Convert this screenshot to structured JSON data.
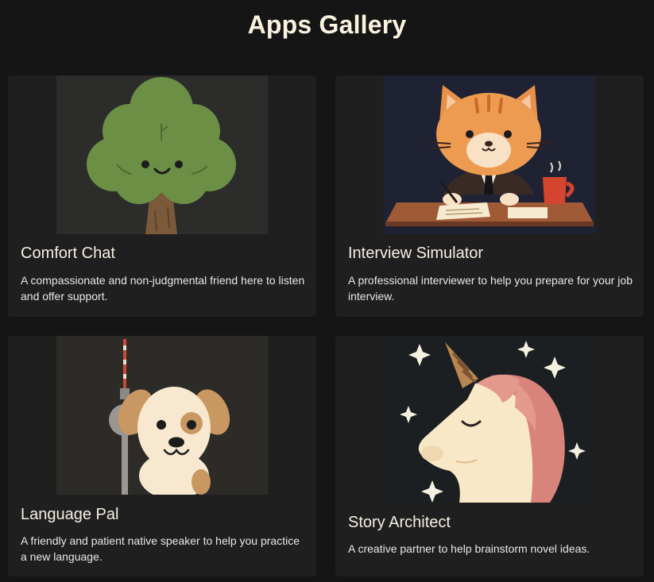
{
  "header": {
    "title": "Apps Gallery"
  },
  "apps": [
    {
      "name": "Comfort Chat",
      "description": "A compassionate and non-judgmental friend here to listen and offer support.",
      "icon": "smiling-tree-icon"
    },
    {
      "name": "Interview Simulator",
      "description": "A professional interviewer to help you prepare for your job interview.",
      "icon": "cat-in-suit-icon"
    },
    {
      "name": "Language Pal",
      "description": "A friendly and patient native speaker to help you practice a new language.",
      "icon": "puppy-tv-tower-icon"
    },
    {
      "name": "Story Architect",
      "description": "A creative partner to help brainstorm novel ideas.",
      "icon": "unicorn-icon"
    }
  ],
  "colors": {
    "background": "#151515",
    "card": "#1f1f1f",
    "title": "#fbf3df"
  }
}
